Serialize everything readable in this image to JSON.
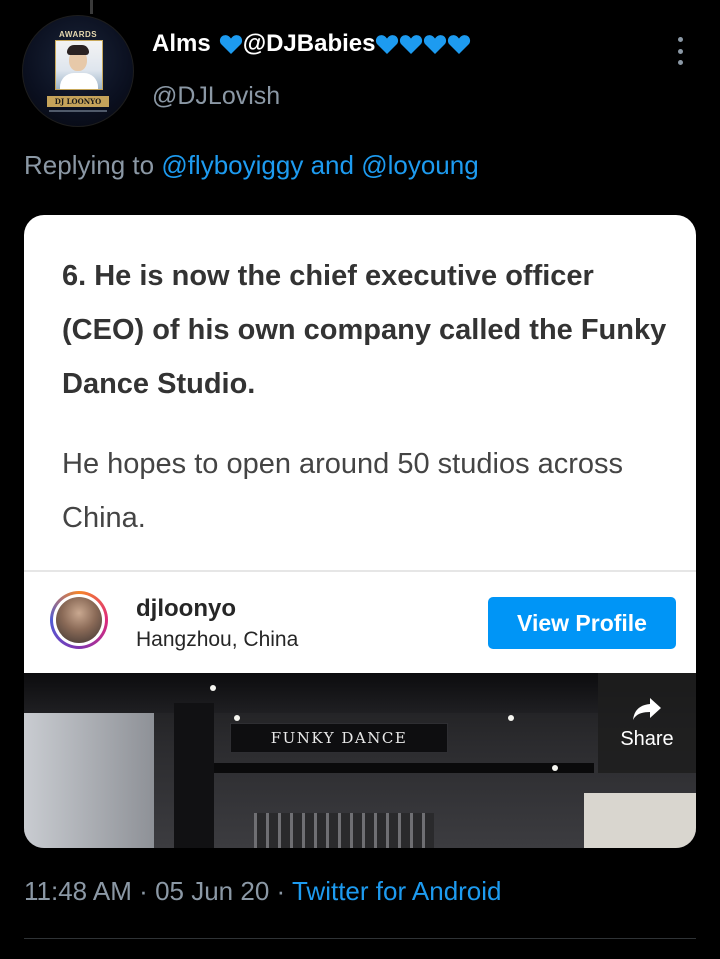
{
  "tweet": {
    "display_name": "Alms",
    "display_name_suffix": "@DJBabies",
    "handle": "@DJLovish",
    "avatar": {
      "badge_text": "AWARDS",
      "name_plate": "DJ LOONYO"
    },
    "replying_prefix": "Replying to",
    "replying_user1": "@flyboyiggy",
    "replying_and": "and",
    "replying_user2": "@loyoung",
    "time": "11:48 AM",
    "date": "05 Jun 20",
    "separator": "·",
    "source": "Twitter for Android"
  },
  "card": {
    "heading": "6. He is now the chief executive officer (CEO) of his own company called the Funky Dance Studio.",
    "subtext": "He hopes to open around 50 studios across China.",
    "instagram": {
      "username": "djloonyo",
      "location": "Hangzhou, China",
      "view_profile_label": "View Profile"
    },
    "photo": {
      "sign_text": "FUNKY DANCE",
      "share_label": "Share"
    }
  },
  "colors": {
    "background": "#000000",
    "link": "#1d9bf0",
    "secondary_text": "#8b98a5",
    "heart": "#1d9bf0",
    "instagram_button": "#0095f6"
  },
  "icons": {
    "heart": "blue-heart-icon",
    "more": "more-vertical-icon",
    "share": "share-arrow-icon"
  }
}
